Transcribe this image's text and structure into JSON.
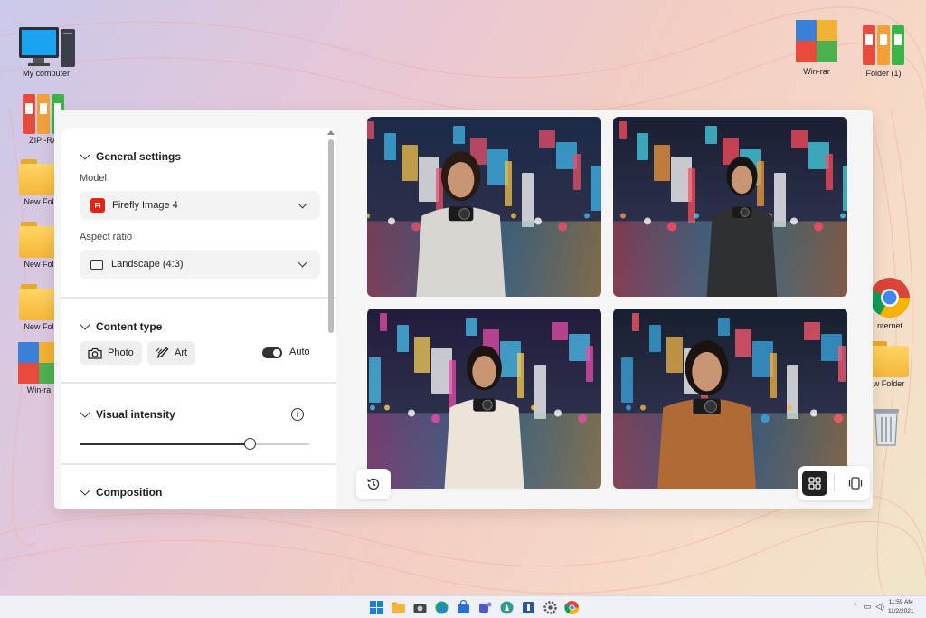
{
  "desktop": {
    "icons_left": [
      {
        "label": "My computer",
        "icon": "computer-icon"
      },
      {
        "label": "ZIP -RA",
        "icon": "archive-icon"
      },
      {
        "label": "New Fol",
        "icon": "folder-icon"
      },
      {
        "label": "New Fol",
        "icon": "folder-icon"
      },
      {
        "label": "New Fol",
        "icon": "folder-icon"
      },
      {
        "label": "Win-ra",
        "icon": "winrar-icon"
      }
    ],
    "icons_right": [
      {
        "label": "Win-rar",
        "icon": "winrar-icon"
      },
      {
        "label": "Folder (1)",
        "icon": "binders-icon"
      },
      {
        "label": "nternet",
        "icon": "chrome-icon"
      },
      {
        "label": "w Folder",
        "icon": "folder-icon"
      },
      {
        "label": "",
        "icon": "recycle-bin-icon"
      }
    ]
  },
  "panel": {
    "general": {
      "title": "General settings",
      "model_label": "Model",
      "model_value": "Firefly Image 4",
      "model_logo": "Fi",
      "aspect_label": "Aspect ratio",
      "aspect_value": "Landscape (4:3)"
    },
    "content_type": {
      "title": "Content type",
      "options": [
        "Photo",
        "Art"
      ],
      "auto_label": "Auto",
      "auto_on": true
    },
    "visual_intensity": {
      "title": "Visual intensity",
      "value": 0.74
    },
    "composition": {
      "title": "Composition"
    }
  },
  "gallery": {
    "images": [
      {
        "subject": "woman-with-camera-neon-street",
        "jacket": "#d9d5d0"
      },
      {
        "subject": "man-with-camera-neon-street",
        "jacket": "#2f3033"
      },
      {
        "subject": "woman-with-camera-neon-street",
        "jacket": "#ece4d8"
      },
      {
        "subject": "woman-shooting-camera-neon-street",
        "jacket": "#b06a35"
      }
    ],
    "view_mode": "grid"
  },
  "taskbar": {
    "time": "11:59 AM",
    "date": "11/2/2021"
  }
}
